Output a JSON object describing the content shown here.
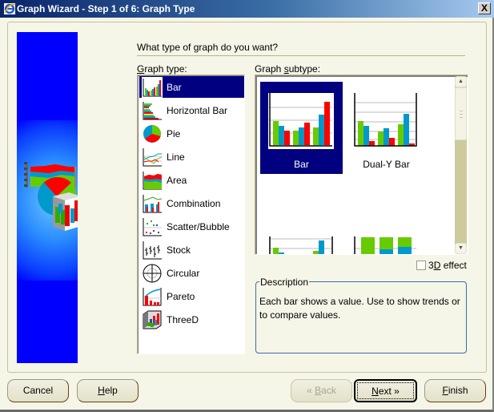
{
  "window": {
    "title": "Graph Wizard - Step 1 of 6: Graph Type",
    "close_label": "X"
  },
  "wizard": {
    "question": "What type of graph do you want?",
    "graph_type_label_mnemonic": "G",
    "graph_type_label_rest": "raph type:",
    "graph_subtype_label_pre": "Graph ",
    "graph_subtype_label_mnemonic": "s",
    "graph_subtype_label_rest": "ubtype:",
    "graph_types": [
      {
        "label": "Bar",
        "icon": "bar-chart-icon",
        "selected": true
      },
      {
        "label": "Horizontal Bar",
        "icon": "horizontal-bar-chart-icon",
        "selected": false
      },
      {
        "label": "Pie",
        "icon": "pie-chart-icon",
        "selected": false
      },
      {
        "label": "Line",
        "icon": "line-chart-icon",
        "selected": false
      },
      {
        "label": "Area",
        "icon": "area-chart-icon",
        "selected": false
      },
      {
        "label": "Combination",
        "icon": "combination-chart-icon",
        "selected": false
      },
      {
        "label": "Scatter/Bubble",
        "icon": "scatter-chart-icon",
        "selected": false
      },
      {
        "label": "Stock",
        "icon": "stock-chart-icon",
        "selected": false
      },
      {
        "label": "Circular",
        "icon": "circular-chart-icon",
        "selected": false
      },
      {
        "label": "Pareto",
        "icon": "pareto-chart-icon",
        "selected": false
      },
      {
        "label": "ThreeD",
        "icon": "threed-chart-icon",
        "selected": false
      }
    ],
    "graph_subtypes": [
      {
        "label": "Bar",
        "selected": true
      },
      {
        "label": "Dual-Y Bar",
        "selected": false
      },
      {
        "label": "",
        "selected": false
      },
      {
        "label": "",
        "selected": false
      }
    ],
    "threed_effect": {
      "label_pre": "3",
      "label_mnemonic": "D",
      "label_rest": " effect",
      "checked": false
    },
    "description": {
      "legend": "Description",
      "text": "Each bar shows a value. Use to show trends or to compare values."
    }
  },
  "buttons": {
    "cancel": "Cancel",
    "help_mnemonic": "H",
    "help_rest": "elp",
    "back_arrow": "«",
    "back_mnemonic": "B",
    "back_rest": "ack",
    "next_mnemonic": "N",
    "next_rest": "ext",
    "next_arrow": "»",
    "finish_mnemonic": "F",
    "finish_rest": "inish",
    "back_enabled": false
  },
  "colors": {
    "selection": "#000080",
    "series_green": "#66cc00",
    "series_blue": "#0099cc",
    "series_red": "#ff0000",
    "banner_blue": "#0000ff"
  }
}
